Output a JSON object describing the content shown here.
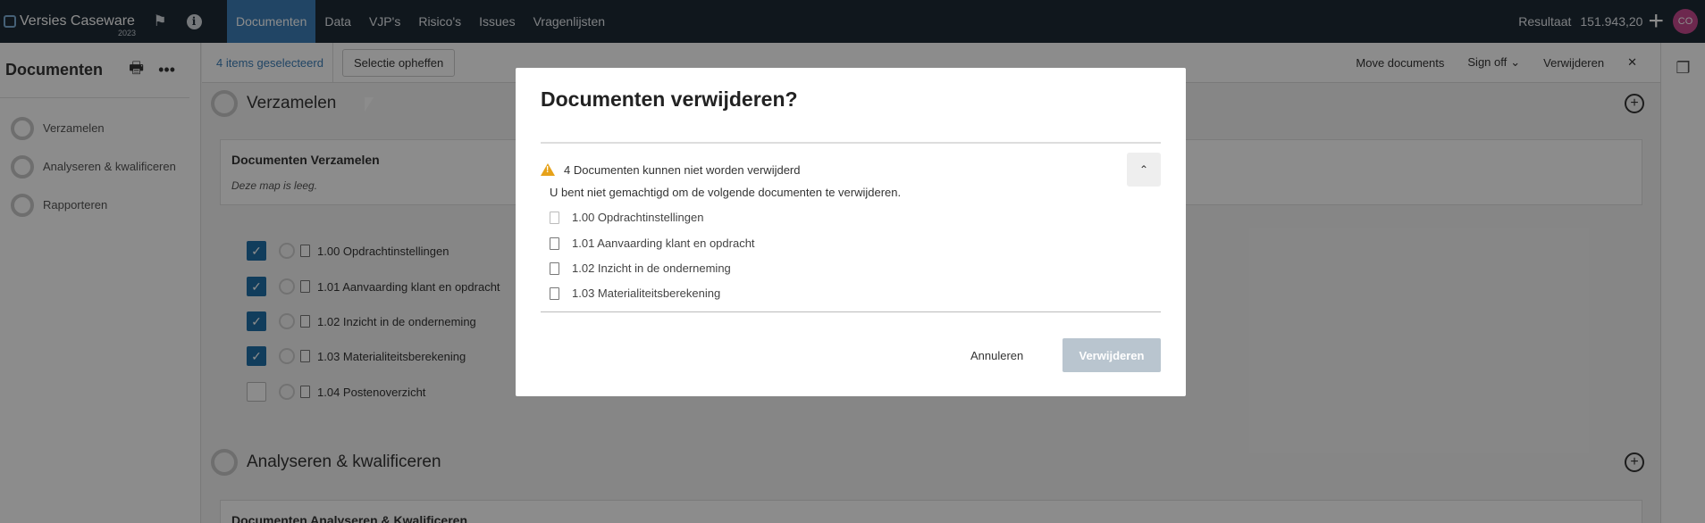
{
  "nav": {
    "brand": "Versies Caseware",
    "year": "2023",
    "tabs": [
      "Documenten",
      "Data",
      "VJP's",
      "Risico's",
      "Issues",
      "Vragenlijsten"
    ],
    "result_label": "Resultaat",
    "result_value": "151.943,20",
    "avatar": "CO"
  },
  "sidebar": {
    "title": "Documenten",
    "items": [
      "Verzamelen",
      "Analyseren & kwalificeren",
      "Rapporteren"
    ]
  },
  "actionbar": {
    "selected": "4 items geselecteerd",
    "clear": "Selectie opheffen",
    "move": "Move documents",
    "signoff": "Sign off",
    "delete": "Verwijderen"
  },
  "main": {
    "section1": "Verzamelen",
    "card1_title": "Documenten Verzamelen",
    "card1_empty": "Deze map is leeg.",
    "docs": [
      {
        "label": "1.00 Opdrachtinstellingen",
        "checked": true
      },
      {
        "label": "1.01 Aanvaarding klant en opdracht",
        "checked": true
      },
      {
        "label": "1.02 Inzicht in de onderneming",
        "checked": true
      },
      {
        "label": "1.03 Materialiteitsberekening",
        "checked": true
      },
      {
        "label": "1.04 Postenoverzicht",
        "checked": false
      }
    ],
    "section2": "Analyseren & kwalificeren",
    "card2_title": "Documenten Analyseren & Kwalificeren"
  },
  "modal": {
    "title": "Documenten verwijderen?",
    "warning": "4 Documenten kunnen niet worden verwijderd",
    "message": "U bent niet gemachtigd om de volgende documenten te verwijderen.",
    "items": [
      "1.00 Opdrachtinstellingen",
      "1.01 Aanvaarding klant en opdracht",
      "1.02 Inzicht in de onderneming",
      "1.03 Materialiteitsberekening"
    ],
    "cancel": "Annuleren",
    "confirm": "Verwijderen"
  },
  "colors": {
    "nav_bg": "#1e2a35",
    "accent": "#3c7fb8",
    "warning": "#e6a21a",
    "disabled_button": "#b9c5cf"
  }
}
